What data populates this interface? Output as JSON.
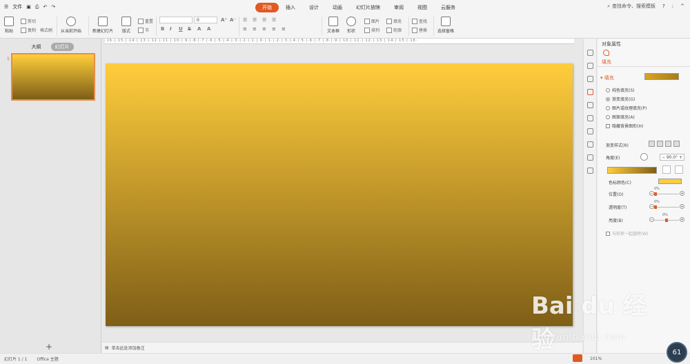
{
  "titlebar": {
    "menu_file": "文件",
    "tabs": [
      {
        "label": "开始",
        "active": true
      },
      {
        "label": "插入",
        "active": false
      },
      {
        "label": "设计",
        "active": false
      },
      {
        "label": "动画",
        "active": false
      },
      {
        "label": "幻灯片放映",
        "active": false
      },
      {
        "label": "审阅",
        "active": false
      },
      {
        "label": "视图",
        "active": false
      },
      {
        "label": "云服务",
        "active": false
      }
    ],
    "search_placeholder": "查找命令、搜索模板",
    "help": "?",
    "more": ":",
    "collapse": "^"
  },
  "ribbon": {
    "paste": "粘贴",
    "cut": "剪切",
    "copy": "复制",
    "format_painter": "格式刷",
    "from_current": "从当前开始",
    "new_slide": "新建幻灯片",
    "layout": "版式",
    "reset": "重置",
    "section": "节",
    "font_size": "0",
    "bold": "B",
    "italic": "I",
    "underline": "U",
    "strike": "S",
    "textbox": "文本框",
    "shape": "形状",
    "picture": "图片",
    "fill": "填充",
    "arrange": "排列",
    "outline": "轮廓",
    "find": "查找",
    "replace": "替换",
    "select_pane": "选择窗格"
  },
  "left_panel": {
    "tab_outline": "大纲",
    "tab_slides": "幻灯片",
    "slide_number": "1",
    "add": "+"
  },
  "notes": {
    "placeholder": "单击此处添加备注"
  },
  "status": {
    "slide_info": "幻灯片 1 / 1",
    "theme": "Office 主题",
    "zoom": "101%"
  },
  "right_panel": {
    "title": "对象属性",
    "fill_tab": "填充",
    "fill_section": "填充",
    "options": [
      {
        "label": "纯色填充(S)",
        "type": "radio",
        "checked": false
      },
      {
        "label": "渐变填充(G)",
        "type": "radio",
        "checked": true
      },
      {
        "label": "图片或纹理填充(P)",
        "type": "radio",
        "checked": false
      },
      {
        "label": "图案填充(A)",
        "type": "radio",
        "checked": false
      },
      {
        "label": "隐藏背景图形(H)",
        "type": "checkbox",
        "checked": false
      }
    ],
    "gradient_style": "渐变样式(R)",
    "angle_label": "角度(E)",
    "angle_value": "90.0°",
    "minus": "−",
    "plus": "+",
    "stop_color": "色标颜色(C)",
    "position": "位置(O)",
    "transparency": "透明度(T)",
    "brightness": "亮度(B)",
    "position_value": "0%",
    "transparency_value": "0%",
    "brightness_value": "0%",
    "rotate_with_shape": "与形状一起旋转(W)"
  },
  "watermark": {
    "brand": "Bai du 经验",
    "url": "jingyan.baidu.com"
  },
  "gauge": {
    "value": "61"
  }
}
